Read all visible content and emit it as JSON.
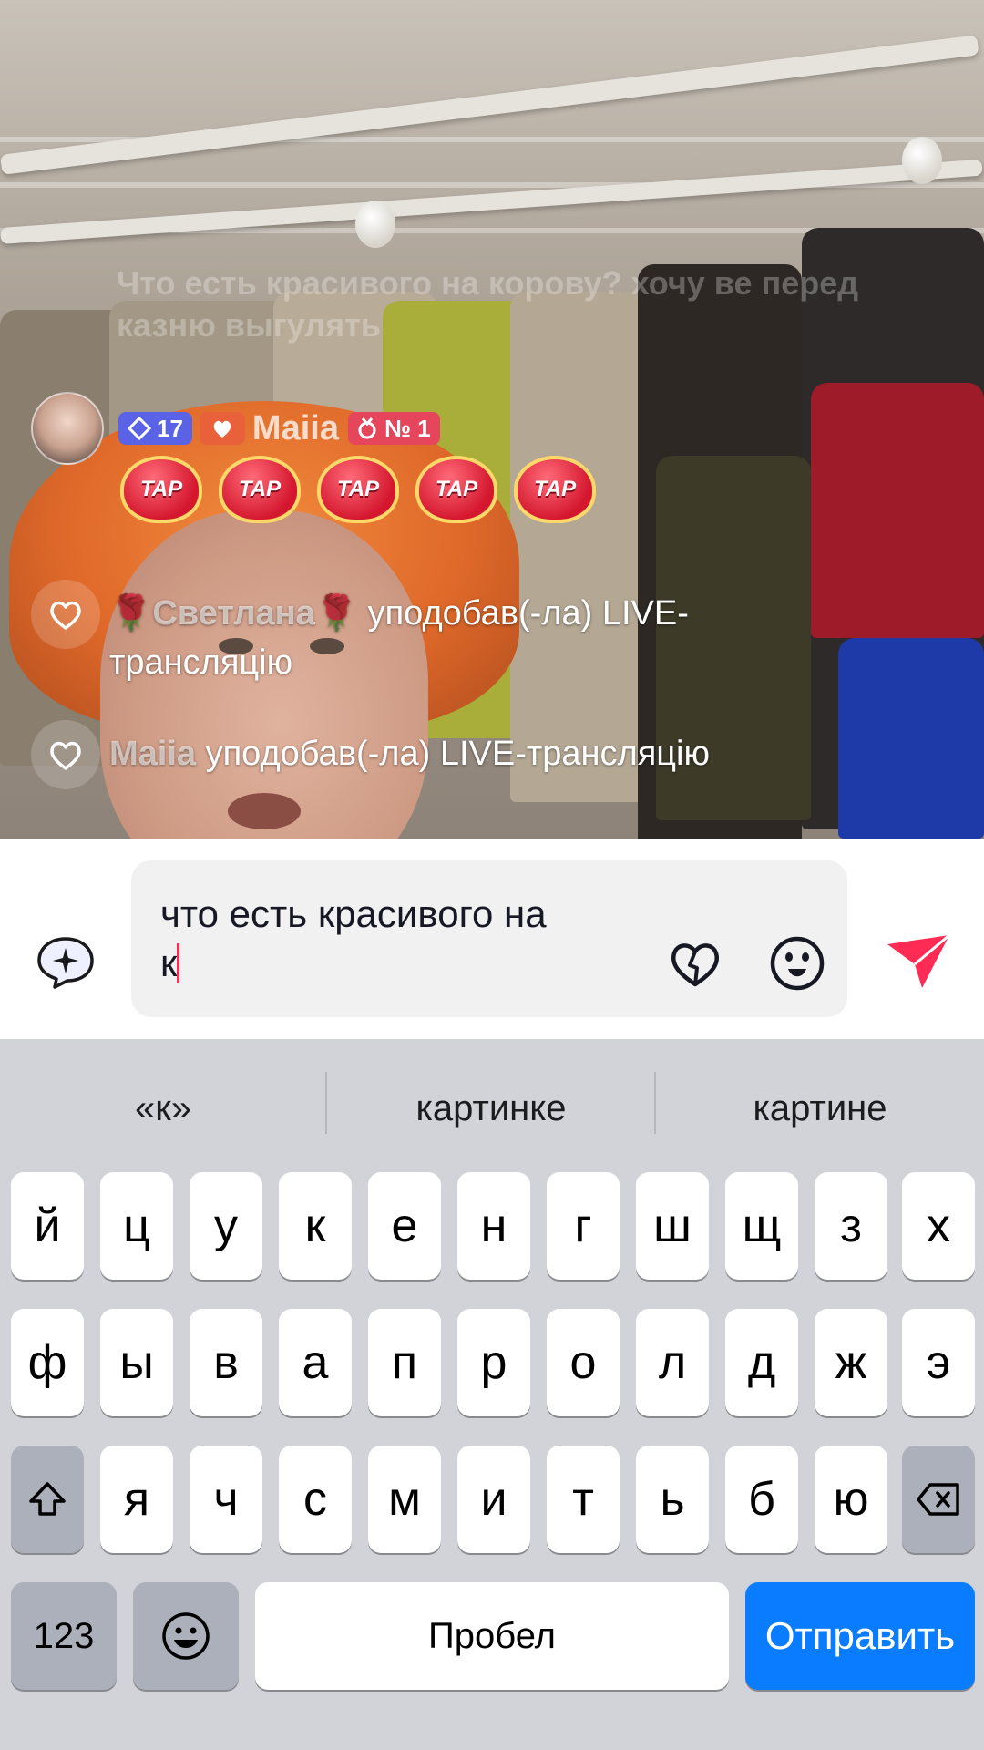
{
  "live": {
    "faded_comment": "Что есть красивого на корову? хочу ве перед казню выгулять",
    "gift": {
      "level": "17",
      "username": "Maiia",
      "rank": "№ 1",
      "tap_label": "TAP"
    },
    "events": [
      {
        "name": "🌹Светлана🌹",
        "text": " уподобав(-ла) LIVE-трансляцію"
      },
      {
        "name": "Maiia",
        "text": " уподобав(-ла) LIVE-трансляцію"
      }
    ]
  },
  "comment": {
    "value": "что есть красивого на\nк"
  },
  "keyboard": {
    "suggestions": [
      "«к»",
      "картинке",
      "картине"
    ],
    "row1": [
      "й",
      "ц",
      "у",
      "к",
      "е",
      "н",
      "г",
      "ш",
      "щ",
      "з",
      "х"
    ],
    "row2": [
      "ф",
      "ы",
      "в",
      "а",
      "п",
      "р",
      "о",
      "л",
      "д",
      "ж",
      "э"
    ],
    "row3": [
      "я",
      "ч",
      "с",
      "м",
      "и",
      "т",
      "ь",
      "б",
      "ю"
    ],
    "numbers_key": "123",
    "space_key": "Пробел",
    "send_key": "Отправить"
  },
  "colors": {
    "accent": "#fe2c55",
    "send_key": "#0a7cff"
  }
}
